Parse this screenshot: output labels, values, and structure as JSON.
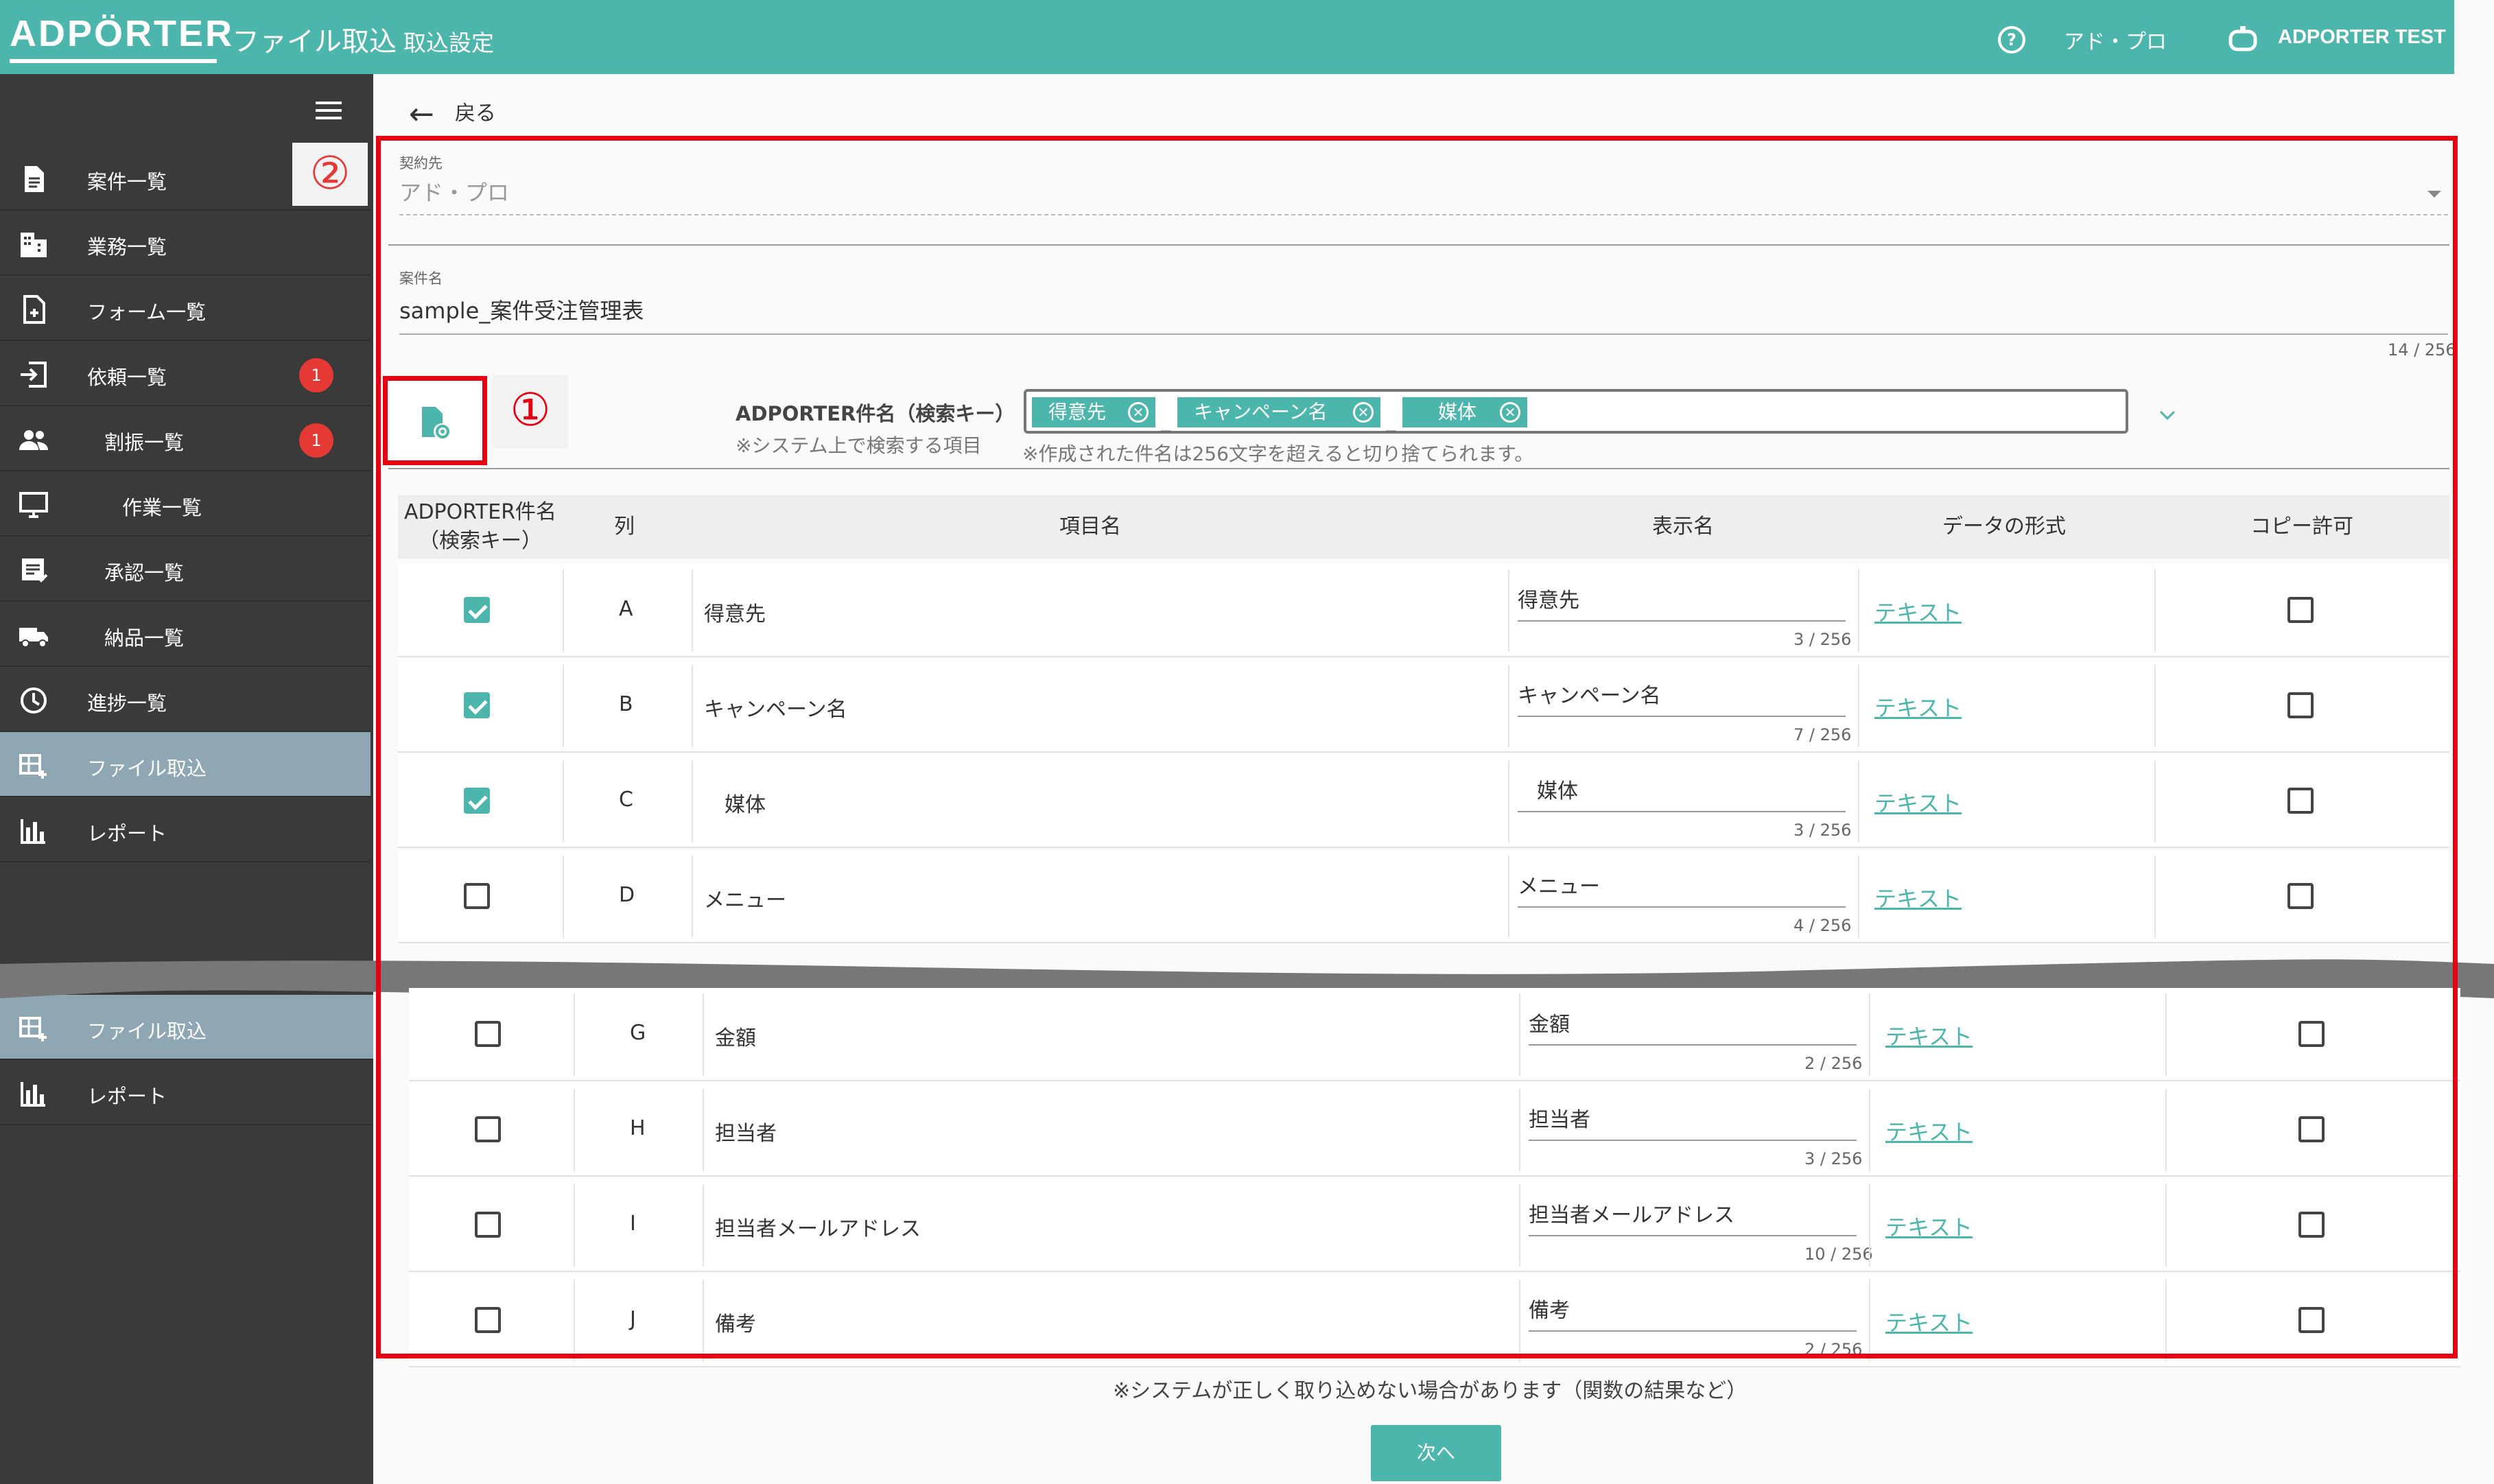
{
  "header": {
    "logo": "ADPÖRTER",
    "title": "ファイル取込",
    "subtitle": "取込設定",
    "company": "アド・プロ",
    "user": "ADPORTER TEST",
    "bg_color": "#4db6ac"
  },
  "sidebar": {
    "items": [
      {
        "label": "案件一覧",
        "icon": "document-icon"
      },
      {
        "label": "業務一覧",
        "icon": "building-icon"
      },
      {
        "label": "フォーム一覧",
        "icon": "form-icon"
      },
      {
        "label": "依頼一覧",
        "icon": "login-icon",
        "badge": "1"
      },
      {
        "label": "割振一覧",
        "icon": "people-icon",
        "badge": "1"
      },
      {
        "label": "作業一覧",
        "icon": "monitor-icon"
      },
      {
        "label": "承認一覧",
        "icon": "approval-icon"
      },
      {
        "label": "納品一覧",
        "icon": "truck-icon"
      },
      {
        "label": "進捗一覧",
        "icon": "clock-icon"
      },
      {
        "label": "ファイル取込",
        "icon": "table-add-icon"
      },
      {
        "label": "レポート",
        "icon": "bar-chart-icon"
      }
    ],
    "items_lower": [
      {
        "label": "ファイル取込",
        "icon": "table-add-icon"
      },
      {
        "label": "レポート",
        "icon": "bar-chart-icon"
      }
    ]
  },
  "back_label": "戻る",
  "annotations": {
    "one": "①",
    "two": "②"
  },
  "form": {
    "contractor_label": "契約先",
    "contractor_value": "アド・プロ",
    "project_label": "案件名",
    "project_value": "sample_案件受注管理表",
    "project_counter": "14 / 256"
  },
  "key": {
    "label": "ADPORTER件名（検索キー）",
    "note": "※システム上で検索する項目",
    "chips": [
      "得意先",
      "キャンペーン名",
      "媒体"
    ],
    "separator": "_",
    "chip_note": "※作成された件名は256文字を超えると切り捨てられます。"
  },
  "table": {
    "headers": [
      "ADPORTER件名\n（検索キー）",
      "列",
      "項目名",
      "表示名",
      "データの形式",
      "コピー許可"
    ],
    "rows_upper": [
      {
        "checked": true,
        "col": "A",
        "item": "得意先",
        "display": "得意先",
        "counter": "3 / 256",
        "format": "テキスト"
      },
      {
        "checked": true,
        "col": "B",
        "item": "キャンペーン名",
        "display": "キャンペーン名",
        "counter": "7 / 256",
        "format": "テキスト"
      },
      {
        "checked": true,
        "col": "C",
        "item": "媒体",
        "display": "媒体",
        "counter": "3 / 256",
        "format": "テキスト"
      },
      {
        "checked": false,
        "col": "D",
        "item": "メニュー",
        "display": "メニュー",
        "counter": "4 / 256",
        "format": "テキスト"
      }
    ],
    "rows_lower": [
      {
        "checked": false,
        "col": "G",
        "item": "金額",
        "display": "金額",
        "counter": "2 / 256",
        "format": "テキスト"
      },
      {
        "checked": false,
        "col": "H",
        "item": "担当者",
        "display": "担当者",
        "counter": "3 / 256",
        "format": "テキスト"
      },
      {
        "checked": false,
        "col": "I",
        "item": "担当者メールアドレス",
        "display": "担当者メールアドレス",
        "counter": "10 / 256",
        "format": "テキスト"
      },
      {
        "checked": false,
        "col": "J",
        "item": "備考",
        "display": "備考",
        "counter": "2 / 256",
        "format": "テキスト"
      }
    ]
  },
  "footer_note": "※システムが正しく取り込めない場合があります（関数の結果など）",
  "next_label": "次へ"
}
